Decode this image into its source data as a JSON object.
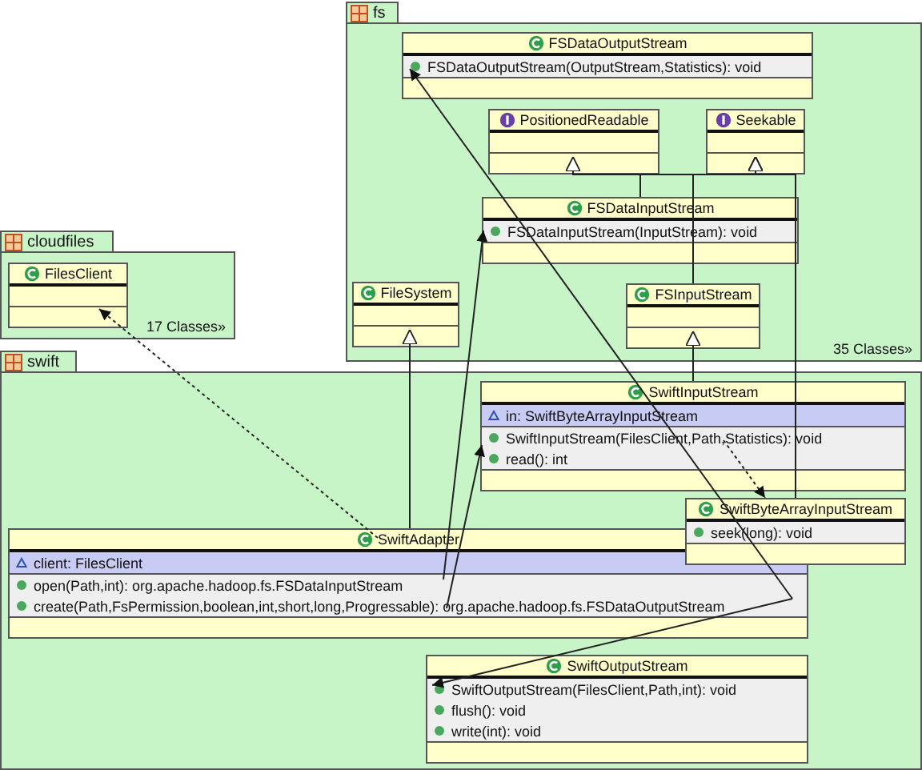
{
  "packages": [
    {
      "name": "fs",
      "footer": "35 Classes»",
      "classes": [
        {
          "name": "FSDataOutputStream",
          "kind": "class",
          "methods": [
            {
              "text": "FSDataOutputStream(OutputStream,Statistics): void",
              "kind": "public"
            }
          ]
        },
        {
          "name": "PositionedReadable",
          "kind": "interface"
        },
        {
          "name": "Seekable",
          "kind": "interface"
        },
        {
          "name": "FSDataInputStream",
          "kind": "class",
          "methods": [
            {
              "text": "FSDataInputStream(InputStream): void",
              "kind": "public"
            }
          ]
        },
        {
          "name": "FileSystem",
          "kind": "class"
        },
        {
          "name": "FSInputStream",
          "kind": "class"
        }
      ]
    },
    {
      "name": "cloudfiles",
      "footer": "17 Classes»",
      "classes": [
        {
          "name": "FilesClient",
          "kind": "class"
        }
      ]
    },
    {
      "name": "swift",
      "classes": [
        {
          "name": "SwiftInputStream",
          "kind": "class",
          "attributes": [
            {
              "text": "in: SwiftByteArrayInputStream",
              "kind": "package"
            }
          ],
          "methods": [
            {
              "text": "SwiftInputStream(FilesClient,Path,Statistics): void",
              "kind": "public"
            },
            {
              "text": "read(): int",
              "kind": "public"
            }
          ]
        },
        {
          "name": "SwiftByteArrayInputStream",
          "kind": "class",
          "methods": [
            {
              "text": "seek(long): void",
              "kind": "public"
            }
          ]
        },
        {
          "name": "SwiftAdapter",
          "kind": "class",
          "attributes": [
            {
              "text": "client: FilesClient",
              "kind": "package"
            }
          ],
          "methods": [
            {
              "text": "open(Path,int): org.apache.hadoop.fs.FSDataInputStream",
              "kind": "public"
            },
            {
              "text": "create(Path,FsPermission,boolean,int,short,long,Progressable): org.apache.hadoop.fs.FSDataOutputStream",
              "kind": "public"
            }
          ]
        },
        {
          "name": "SwiftOutputStream",
          "kind": "class",
          "methods": [
            {
              "text": "SwiftOutputStream(FilesClient,Path,int): void",
              "kind": "public"
            },
            {
              "text": "flush(): void",
              "kind": "public"
            },
            {
              "text": "write(int): void",
              "kind": "public"
            }
          ]
        }
      ]
    }
  ],
  "relations": [
    {
      "kind": "realization"
    },
    {
      "kind": "realization"
    },
    {
      "kind": "generalization"
    },
    {
      "kind": "generalization"
    },
    {
      "kind": "generalization"
    },
    {
      "kind": "generalization"
    },
    {
      "kind": "dependency"
    },
    {
      "kind": "dependency"
    },
    {
      "kind": "association"
    },
    {
      "kind": "association"
    },
    {
      "kind": "association"
    },
    {
      "kind": "association"
    }
  ]
}
